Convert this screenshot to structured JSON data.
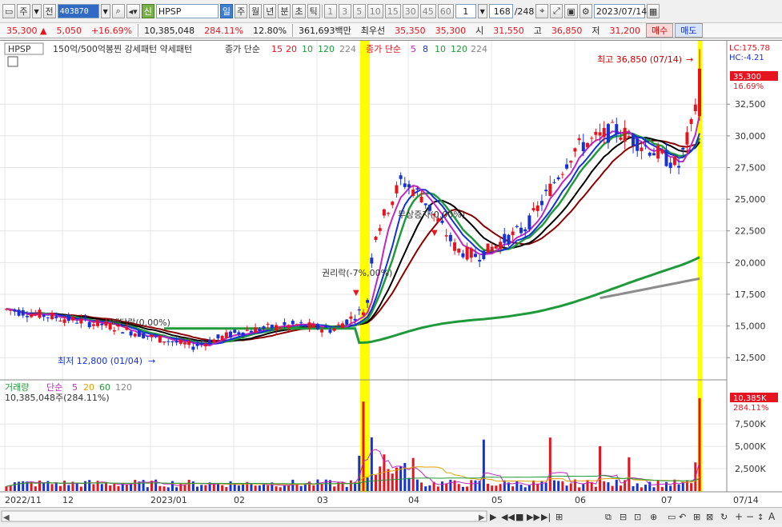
{
  "toolbar": {
    "market": "주",
    "period_type": "전",
    "code": "403870",
    "badge": "신",
    "name": "HPSP",
    "periods": [
      "일",
      "주",
      "월",
      "년",
      "분",
      "초",
      "틱"
    ],
    "active_period": "일",
    "numbers": [
      "1",
      "3",
      "5",
      "10",
      "15",
      "30",
      "45",
      "60"
    ],
    "count_value": "1",
    "page": "168",
    "page_total": "/248",
    "date": "2023/07/14"
  },
  "quote": {
    "price": "35,300",
    "arrow": "▲",
    "change": "5,050",
    "change_pct": "+16.69%",
    "volume": "10,385,048",
    "volume_pct": "284.11%",
    "turnover_pct": "12.80%",
    "amount": "361,693백만",
    "pref_label": "최우선",
    "ask": "35,350",
    "bid": "35,300",
    "open_label": "시",
    "open": "31,550",
    "high_label": "고",
    "high": "36,850",
    "low_label": "저",
    "low": "31,200",
    "buy": "매수",
    "sell": "매도"
  },
  "price_panel": {
    "stock_label": "HPSP",
    "title": "150억/500억봉찐 강세패턴   약세패턴",
    "ma_label": "종가 단순",
    "ma_periods_a": [
      "15",
      "20",
      "10",
      "120",
      "224"
    ],
    "ma_label_b": "종가 단순",
    "ma_periods_b": [
      "5",
      "8",
      "10",
      "120",
      "224"
    ],
    "high_annot": "최고 36,850 (07/14)",
    "low_annot": "최저 12,800 (01/04)",
    "annot_dividend": "배당락(0.00%)",
    "annot_rights": "권리락(-7%,00%)",
    "annot_free": "무상증자(0.00%)",
    "lc": "LC:175.78",
    "hc": "HC:-4.21",
    "cur_price": "35,300",
    "cur_pct": "16.69%",
    "y_ticks": [
      "32,500",
      "30,000",
      "27,500",
      "25,000",
      "22,500",
      "20,000",
      "17,500",
      "15,000",
      "12,500"
    ]
  },
  "volume_panel": {
    "label": "거래량",
    "ma_label": "단순",
    "ma_periods": [
      "5",
      "20",
      "60",
      "120"
    ],
    "value_text": "10,385,048주(284.11%)",
    "cur": "10,385K",
    "cur_pct": "284.11%",
    "y_ticks": [
      "7,500K",
      "5,000K",
      "2,500K"
    ]
  },
  "x_axis": [
    "2022/11",
    "12",
    "2023/01",
    "02",
    "03",
    "04",
    "05",
    "06",
    "07"
  ],
  "x_right": "07/14",
  "colors": {
    "up": "#e5141f",
    "down": "#1432d6",
    "highlight": "#ffff00",
    "ma_green": "#1f9a3a"
  }
}
